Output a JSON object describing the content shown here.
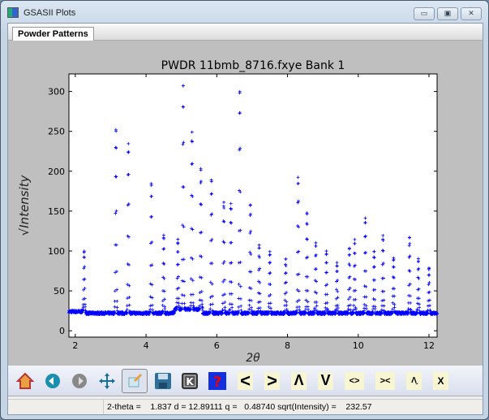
{
  "window": {
    "title": "GSASII Plots",
    "controls": [
      "minimize",
      "maximize",
      "close"
    ]
  },
  "tabs": [
    {
      "label": "Powder Patterns",
      "active": true
    }
  ],
  "toolbar": {
    "buttons": [
      {
        "name": "home",
        "icon": "home-icon"
      },
      {
        "name": "back",
        "icon": "back-arrow-icon"
      },
      {
        "name": "forward",
        "icon": "forward-arrow-icon"
      },
      {
        "name": "pan",
        "icon": "move-icon"
      },
      {
        "name": "zoom",
        "icon": "zoom-rect-icon",
        "active": true
      },
      {
        "name": "save",
        "icon": "floppy-icon"
      },
      {
        "name": "key",
        "icon": "k-key-icon"
      },
      {
        "name": "help",
        "icon": "question-icon"
      }
    ],
    "text_buttons": [
      "<",
      ">",
      "Λ",
      "V",
      "<>",
      "><",
      "Λ̬",
      "X"
    ]
  },
  "status": {
    "text": "2-theta =    1.837 d = 12.89111 q =   0.48740 sqrt(Intensity) =    232.57"
  },
  "chart_data": {
    "type": "scatter",
    "title": "PWDR 11bmb_8716.fxye Bank 1",
    "xlabel": "2θ",
    "ylabel": "√Intensity",
    "xlim": [
      1.82,
      12.23
    ],
    "ylim": [
      -8,
      322
    ],
    "xticks": [
      2,
      4,
      6,
      8,
      10,
      12
    ],
    "yticks": [
      0,
      50,
      100,
      150,
      200,
      250,
      300
    ],
    "marker": "+",
    "color": "#0000ff",
    "baseline": 22,
    "peaks": [
      [
        2.25,
        98
      ],
      [
        3.15,
        254
      ],
      [
        3.5,
        235
      ],
      [
        4.15,
        185
      ],
      [
        4.5,
        120
      ],
      [
        4.9,
        110
      ],
      [
        5.05,
        305
      ],
      [
        5.3,
        243
      ],
      [
        5.55,
        200
      ],
      [
        5.85,
        190
      ],
      [
        6.2,
        162
      ],
      [
        6.4,
        160
      ],
      [
        6.65,
        302
      ],
      [
        6.95,
        160
      ],
      [
        7.2,
        108
      ],
      [
        7.5,
        100
      ],
      [
        7.95,
        90
      ],
      [
        8.3,
        192
      ],
      [
        8.55,
        148
      ],
      [
        8.8,
        110
      ],
      [
        9.1,
        100
      ],
      [
        9.4,
        85
      ],
      [
        9.75,
        105
      ],
      [
        9.9,
        115
      ],
      [
        10.2,
        140
      ],
      [
        10.45,
        100
      ],
      [
        10.7,
        118
      ],
      [
        11.0,
        92
      ],
      [
        11.45,
        118
      ],
      [
        11.7,
        90
      ],
      [
        12.0,
        80
      ]
    ]
  }
}
